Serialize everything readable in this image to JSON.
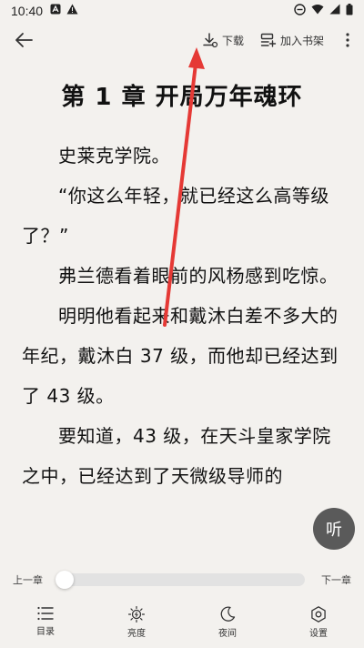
{
  "status": {
    "time": "10:40"
  },
  "toolbar": {
    "download_label": "下载",
    "add_shelf_label": "加入书架"
  },
  "reader": {
    "chapter_title": "第 1 章 开局万年魂环",
    "paragraphs": [
      "史莱克学院。",
      "“你这么年轻，就已经这么高等级了？”",
      "弗兰德看着眼前的风杨感到吃惊。",
      "明明他看起来和戴沐白差不多大的年纪，戴沐白 37 级，而他却已经达到了 43 级。",
      "要知道，43 级，在天斗皇家学院之中，已经达到了天微级导师的"
    ]
  },
  "listen_label": "听",
  "progress": {
    "prev_label": "上一章",
    "next_label": "下一章",
    "value": 0
  },
  "bottom_nav": {
    "items": [
      {
        "label": "目录",
        "icon": "list-icon"
      },
      {
        "label": "亮度",
        "icon": "brightness-icon"
      },
      {
        "label": "夜间",
        "icon": "moon-icon"
      },
      {
        "label": "设置",
        "icon": "settings-icon"
      }
    ]
  },
  "colors": {
    "background": "#f3f1ee",
    "annotation_arrow": "#e53935",
    "listen_button": "#5a5a5a"
  }
}
